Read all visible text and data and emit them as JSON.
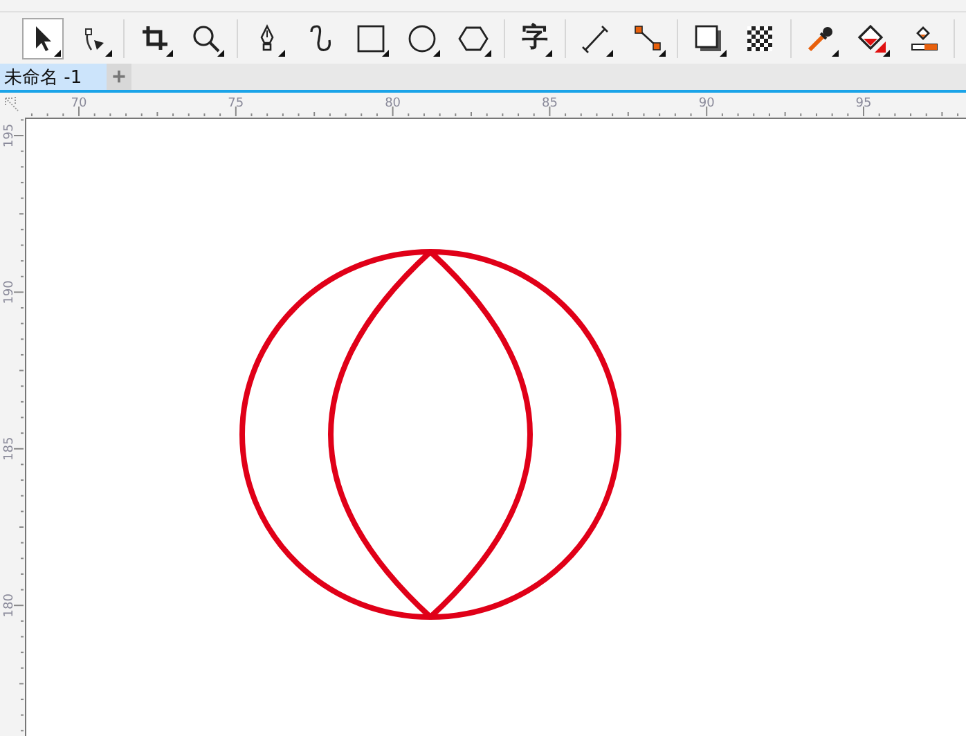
{
  "toolbar": {
    "tools": [
      {
        "kind": "pick",
        "selected": true,
        "flyout": true
      },
      {
        "kind": "shape",
        "selected": false,
        "flyout": true
      },
      {
        "kind": "crop",
        "selected": false,
        "flyout": true
      },
      {
        "kind": "zoom",
        "selected": false,
        "flyout": true
      },
      {
        "kind": "pen",
        "selected": false,
        "flyout": true
      },
      {
        "kind": "curve",
        "selected": false,
        "flyout": false
      },
      {
        "kind": "rectangle",
        "selected": false,
        "flyout": true
      },
      {
        "kind": "ellipse",
        "selected": false,
        "flyout": true
      },
      {
        "kind": "polygon",
        "selected": false,
        "flyout": true
      },
      {
        "kind": "text",
        "glyph": "字",
        "selected": false,
        "flyout": true
      },
      {
        "kind": "dimension",
        "selected": false,
        "flyout": true
      },
      {
        "kind": "connector",
        "selected": false,
        "flyout": true
      },
      {
        "kind": "shadow",
        "selected": false,
        "flyout": true
      },
      {
        "kind": "transparency",
        "selected": false,
        "flyout": false
      },
      {
        "kind": "eyedropper",
        "selected": false,
        "flyout": true
      },
      {
        "kind": "fill",
        "selected": false,
        "flyout": true
      },
      {
        "kind": "smartfill",
        "selected": false,
        "flyout": false
      }
    ]
  },
  "tabs": [
    {
      "label": "未命名 -1",
      "selected": true
    }
  ],
  "add_tab": "+",
  "horizontal_ruler": {
    "labels": [
      "70",
      "75",
      "80",
      "85",
      "90",
      "95"
    ]
  },
  "vertical_ruler": {
    "labels": [
      "195",
      "190",
      "185",
      "180"
    ]
  }
}
